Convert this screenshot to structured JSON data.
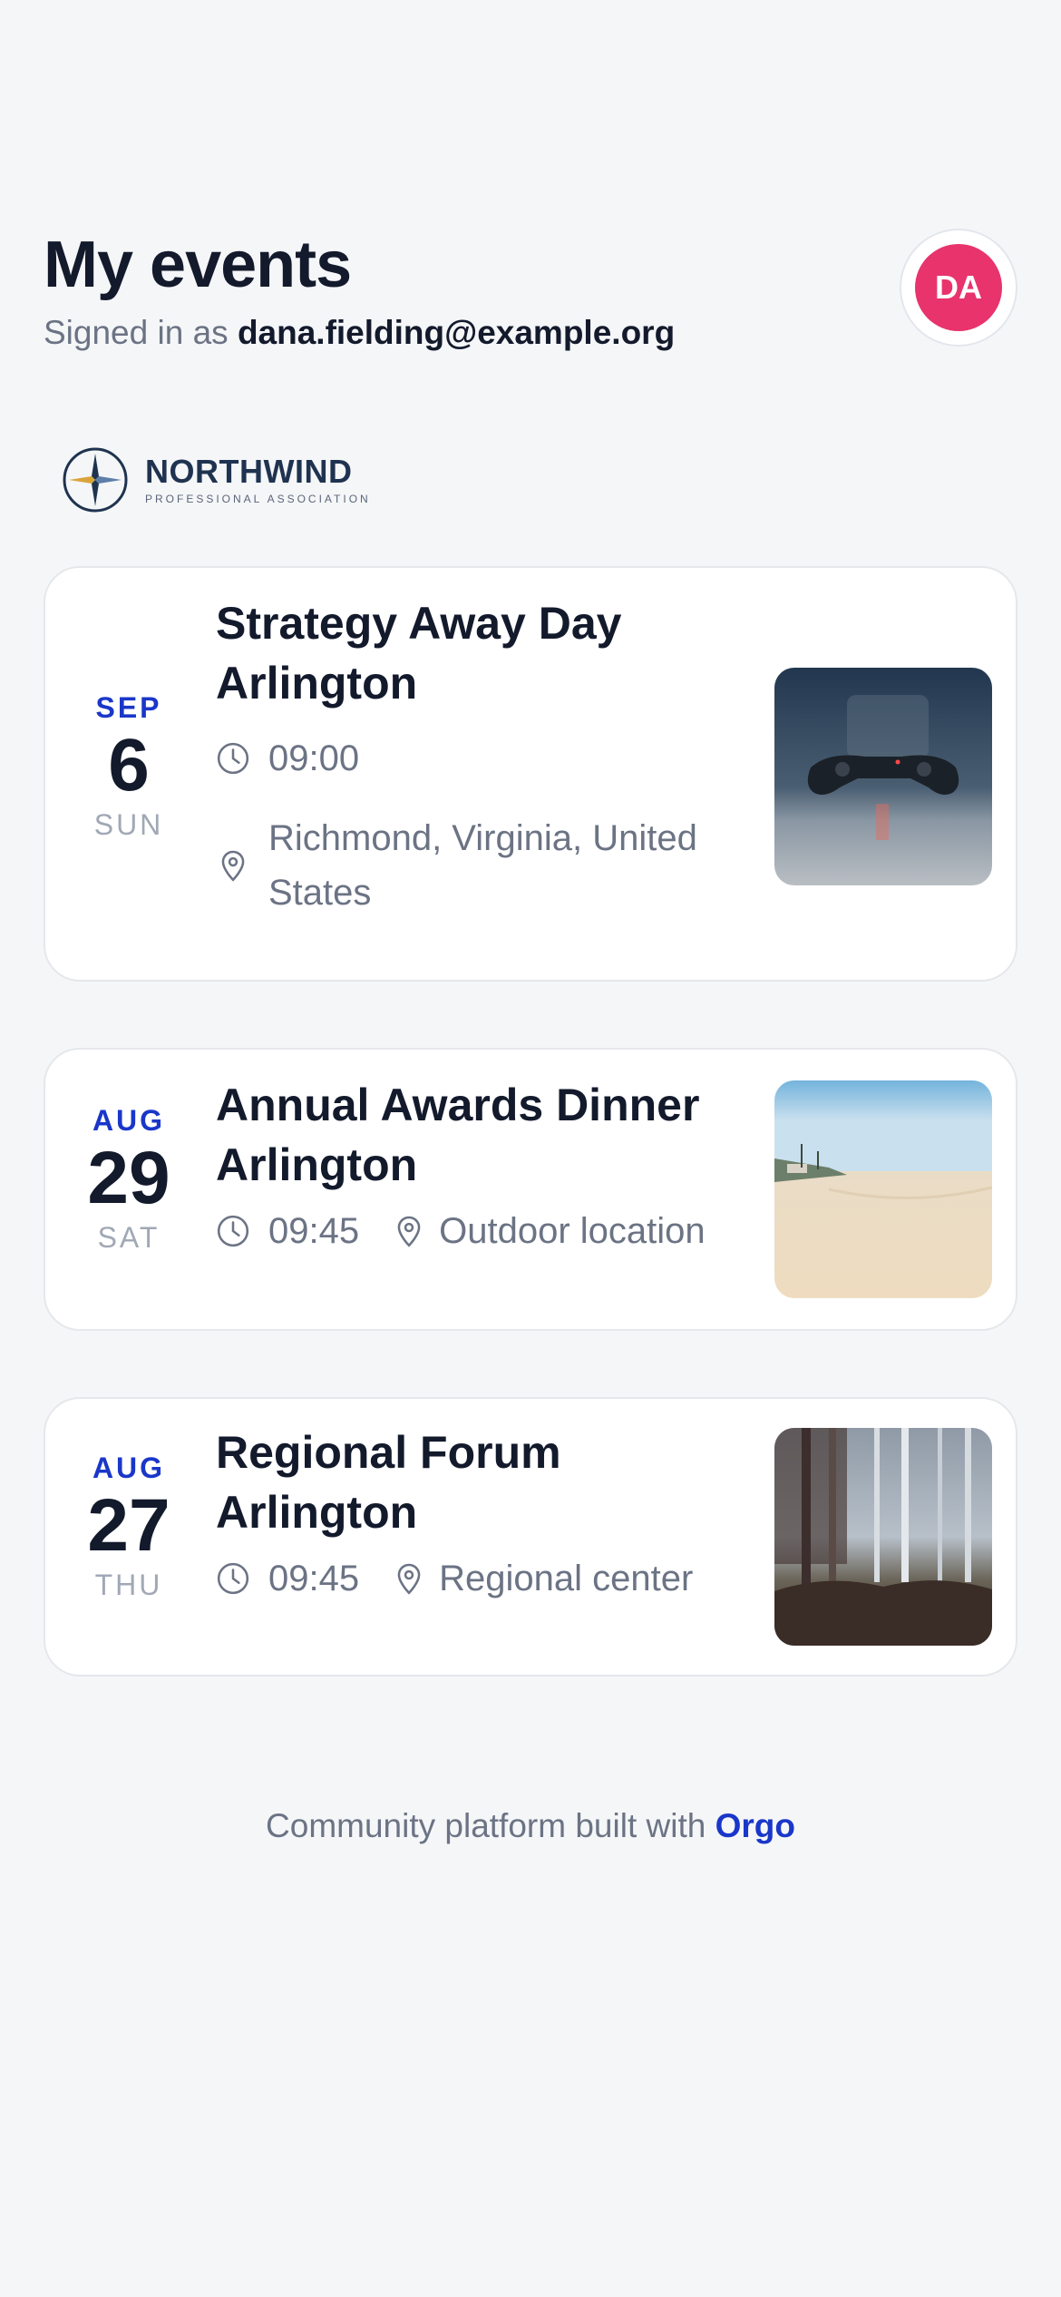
{
  "header": {
    "title": "My events",
    "signed_in_prefix": "Signed in as",
    "email": "dana.fielding@example.org",
    "avatar_initials": "DA"
  },
  "logo": {
    "name": "NORTHWIND",
    "subtitle": "PROFESSIONAL ASSOCIATION"
  },
  "events": [
    {
      "month": "SEP",
      "day": "6",
      "weekday": "SUN",
      "title_line1": "Strategy Away Day",
      "title_line2": "Arlington",
      "time": "09:00",
      "location_line1": "Richmond, Virginia, United",
      "location_line2": "States",
      "image": "game-controller-photo"
    },
    {
      "month": "AUG",
      "day": "29",
      "weekday": "SAT",
      "title_line1": "Annual Awards Dinner",
      "title_line2": "Arlington",
      "time": "09:45",
      "location": "Outdoor location",
      "image": "beach-photo"
    },
    {
      "month": "AUG",
      "day": "27",
      "weekday": "THU",
      "title_line1": "Regional Forum",
      "title_line2": "Arlington",
      "time": "09:45",
      "location": "Regional center",
      "image": "forest-photo"
    }
  ],
  "footer": {
    "prefix": "Community platform built with",
    "link": "Orgo"
  },
  "colors": {
    "accent": "#1a37c9",
    "avatar": "#e8336d",
    "background": "#f5f6f8"
  }
}
